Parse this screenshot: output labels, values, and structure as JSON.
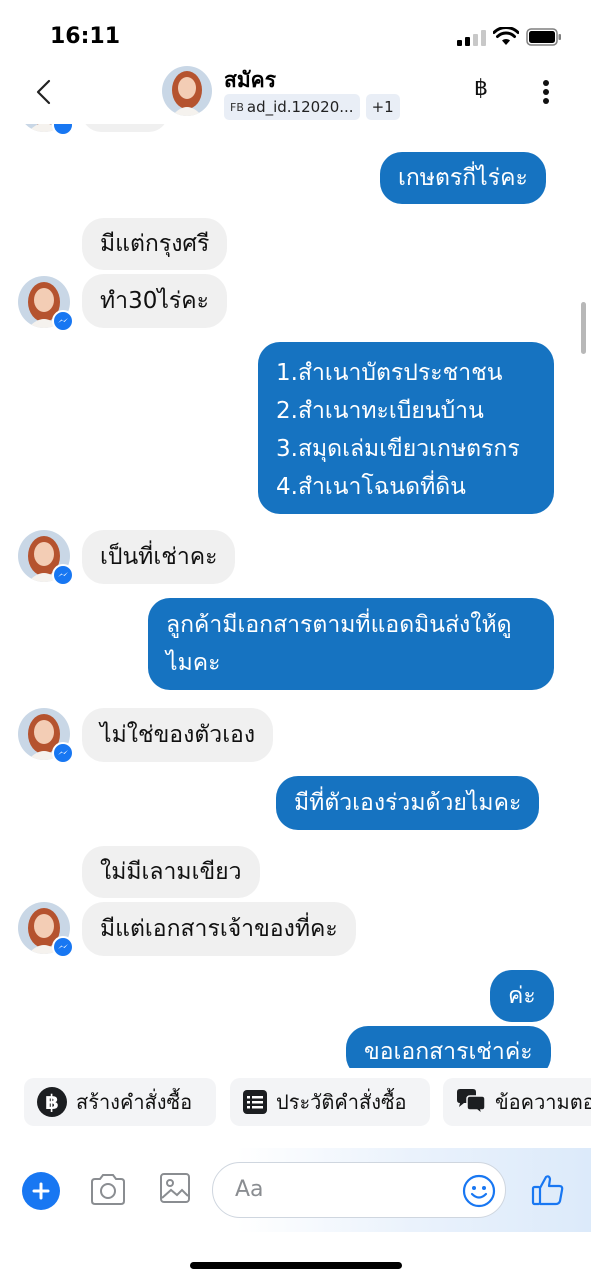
{
  "status": {
    "time": "16:11"
  },
  "header": {
    "contact_name": "สมัคร",
    "tag_prefix": "FB",
    "tag_label": "ad_id.12020...",
    "tag_extra": "+1",
    "currency_symbol": "฿"
  },
  "messages": [
    {
      "from": "them",
      "text": ""
    },
    {
      "from": "me",
      "text": "เกษตรกี่ไร่คะ"
    },
    {
      "from": "them",
      "text": "มีแต่กรุงศรี"
    },
    {
      "from": "them",
      "text": "ทำ30ไร่คะ"
    },
    {
      "from": "me",
      "lines": [
        "1.สำเนาบัตรประชาชน",
        "2.สำเนาทะเบียนบ้าน",
        "3.สมุดเล่มเขียวเกษตรกร",
        "4.สำเนาโฉนดที่ดิน"
      ]
    },
    {
      "from": "them",
      "text": "เป็นที่เช่าคะ"
    },
    {
      "from": "me",
      "lines": [
        "ลูกค้ามีเอกสารตามที่แอดมินส่งให้ดู",
        "ไมคะ"
      ]
    },
    {
      "from": "them",
      "text": "ไม่ใช่ของตัวเอง"
    },
    {
      "from": "me",
      "text": "มีที่ตัวเองร่วมด้วยไมคะ"
    },
    {
      "from": "them",
      "text": "ใม่มีเลามเขียว"
    },
    {
      "from": "them",
      "text": "มีแต่เอกสารเจ้าของที่คะ"
    },
    {
      "from": "me",
      "text": "ค่ะ"
    },
    {
      "from": "me",
      "text": "ขอเอกสารเช่าค่ะ"
    }
  ],
  "quick_replies": [
    {
      "label": "สร้างคำสั่งซื้อ",
      "icon": "baht-circle-icon"
    },
    {
      "label": "ประวัติคำสั่งซื้อ",
      "icon": "list-icon"
    },
    {
      "label": "ข้อความตอ",
      "icon": "chat-bubbles-icon"
    }
  ],
  "composer": {
    "placeholder": "Aa"
  },
  "colors": {
    "outgoing": "#1673c1",
    "incoming": "#f0f0f0",
    "accent": "#1877f2"
  }
}
